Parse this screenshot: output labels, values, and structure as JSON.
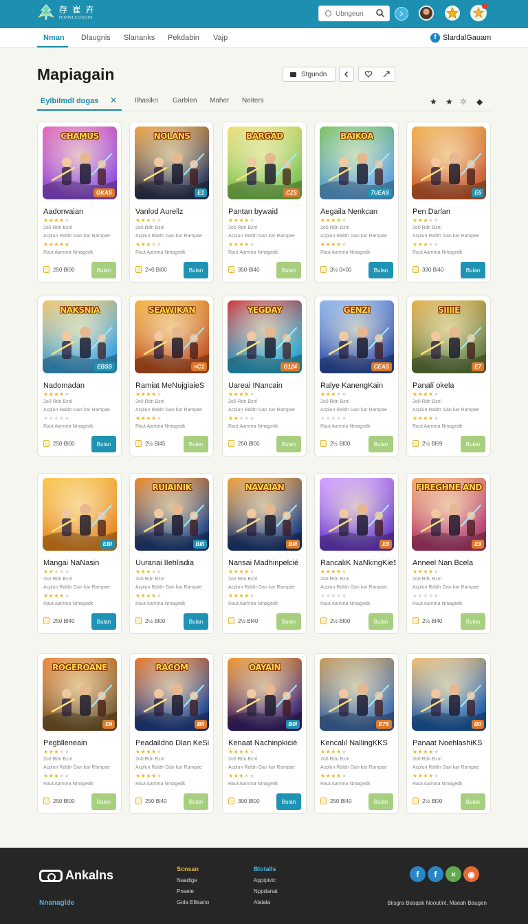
{
  "header": {
    "logo_line1": "存 崔 卉",
    "logo_line2": "RIMWLEGSOIN",
    "search_placeholder": "Ubngeun"
  },
  "nav": {
    "items": [
      "Nman",
      "Dlaugnis",
      "Slananks",
      "Pekdabin",
      "Vajp"
    ],
    "active_index": 0,
    "right_label": "SlardalGauam"
  },
  "page": {
    "title": "Mapiagain",
    "sort_label": "Stgundn",
    "filters": [
      "Eylbilmdl dogas",
      "Ilhasikn",
      "Garblen",
      "Maher",
      "Neiters"
    ]
  },
  "colors": {
    "brand": "#1d90b2",
    "buy_teal": "#1f93b3",
    "buy_green": "#a7cf7f",
    "star": "#f1b41d"
  },
  "card_template": {
    "meta1": "2o0 Rdn Bznl",
    "meta2": "Acplun Raldn Gan kar Rampae",
    "meta4": "Raut Aamma Nmagedk"
  },
  "games": [
    {
      "title": "Aadonvaian",
      "thumb_title": "CHAMUS",
      "tag": "GKAS",
      "buy": "Bulan",
      "buy_style": "green",
      "price": "250 Bl00",
      "rating1": 4,
      "rating3": 5,
      "scene": "#8f4ad8",
      "scene2": "#e46ab8"
    },
    {
      "title": "Vanlod Aurellz",
      "thumb_title": "NOLANS",
      "tag": "E1",
      "buy": "Bulan",
      "buy_style": "teal",
      "price": "2×0 Bl00",
      "rating1": 3,
      "rating3": 3,
      "scene": "#2d3553",
      "scene2": "#f0a440"
    },
    {
      "title": "Pantan bywaid",
      "thumb_title": "BARGAD",
      "tag": "CZS",
      "buy": "Bulan",
      "buy_style": "green",
      "price": "350 Bl40",
      "rating1": 4,
      "rating3": 4,
      "scene": "#7bc24e",
      "scene2": "#f1e07a"
    },
    {
      "title": "Aegaila Nenkcan",
      "thumb_title": "BAIKOA",
      "tag": "7UEAS",
      "buy": "Bulan",
      "buy_style": "teal",
      "price": "3½ 0×00",
      "rating1": 4,
      "rating3": 4,
      "scene": "#5aa0d8",
      "scene2": "#7cc460"
    },
    {
      "title": "Pen Darlan",
      "thumb_title": "",
      "tag": "E6",
      "buy": "Bulan",
      "buy_style": "teal",
      "price": "330 Bl40",
      "rating1": 3,
      "rating3": 3,
      "scene": "#c85a2b",
      "scene2": "#f2b24c"
    },
    {
      "title": "Nadomadan",
      "thumb_title": "NAKSNIA",
      "tag": "EBSS",
      "buy": "Bulan",
      "buy_style": "teal",
      "price": "250 Bl00",
      "rating1": 4,
      "rating3": 0,
      "scene": "#3b9fd8",
      "scene2": "#f3c66a"
    },
    {
      "title": "Ramiat MeNujgiaieS",
      "thumb_title": "SEAWIKAN",
      "tag": "×C1",
      "buy": "Bulan",
      "buy_style": "green",
      "price": "2½ Bl45",
      "rating1": 4,
      "rating3": 4,
      "scene": "#c0521e",
      "scene2": "#f5b540"
    },
    {
      "title": "Uareai INancain",
      "thumb_title": "YEGDAY",
      "tag": "G124",
      "buy": "Bulan",
      "buy_style": "green",
      "price": "250 Bl00",
      "rating1": 4,
      "rating3": 2,
      "scene": "#2aa0c8",
      "scene2": "#d23a3a"
    },
    {
      "title": "Ralye KanengKain",
      "thumb_title": "GENZI",
      "tag": "CEAS",
      "buy": "Bulan",
      "buy_style": "green",
      "price": "2½ Bl00",
      "rating1": 3,
      "rating3": 0,
      "scene": "#2f4ea6",
      "scene2": "#8fb6ee"
    },
    {
      "title": "Panalí okela",
      "thumb_title": "SIIIIE",
      "tag": "E7",
      "buy": "Bulan",
      "buy_style": "green",
      "price": "2½ Bl69",
      "rating1": 4,
      "rating3": 4,
      "scene": "#5f7a3a",
      "scene2": "#e7b24c"
    },
    {
      "title": "Mangai NaNasin",
      "thumb_title": "",
      "tag": "EBI",
      "buy": "Bulan",
      "buy_style": "teal",
      "price": "250 Bl40",
      "rating1": 2,
      "rating3": 4,
      "scene": "#e6871e",
      "scene2": "#f9c84a"
    },
    {
      "title": "Uuranai IIehlisdia",
      "thumb_title": "RUIAINIK",
      "tag": "BIII",
      "buy": "Bulan",
      "buy_style": "teal",
      "price": "2½ Bl00",
      "rating1": 3,
      "rating3": 4,
      "scene": "#1f3f7a",
      "scene2": "#f08a2a"
    },
    {
      "title": "Nansai Madhinpelcié",
      "thumb_title": "NAVAIAN",
      "tag": "B0I",
      "buy": "Bulan",
      "buy_style": "green",
      "price": "2½ Bl40",
      "rating1": 4,
      "rating3": 4,
      "scene": "#1c3a78",
      "scene2": "#f4a038"
    },
    {
      "title": "RancalıK NaNkingKieS",
      "thumb_title": "",
      "tag": "E9",
      "buy": "Bulan",
      "buy_style": "green",
      "price": "2½ Bl00",
      "rating1": 4,
      "rating3": 0,
      "scene": "#6a3cc8",
      "scene2": "#d6a0ff"
    },
    {
      "title": "Anneel Nan Bcela",
      "thumb_title": "FIREGHNE AND",
      "tag": "E9",
      "buy": "Bulan",
      "buy_style": "green",
      "price": "2½ Bl40",
      "rating1": 4,
      "rating3": 0,
      "scene": "#b43a6c",
      "scene2": "#f2ad6c"
    },
    {
      "title": "Pegblleneain",
      "thumb_title": "ROGEROANE",
      "tag": "E9",
      "buy": "Bulan",
      "buy_style": "green",
      "price": "250 Bl00",
      "rating1": 3,
      "rating3": 3,
      "scene": "#7a5a2a",
      "scene2": "#ee8a3a"
    },
    {
      "title": "Peadaildno Dlan KeSi",
      "thumb_title": "RACOM",
      "tag": "BII",
      "buy": "Bulan",
      "buy_style": "green",
      "price": "250 Bl40",
      "rating1": 4,
      "rating3": 4,
      "scene": "#21408a",
      "scene2": "#ef7a28"
    },
    {
      "title": "Kenaat Nachinpkicié",
      "thumb_title": "OAYAIN",
      "tag": "B0I",
      "buy": "Bulan",
      "buy_style": "teal",
      "price": "300 Bl00",
      "rating1": 4,
      "rating3": 3,
      "scene": "#3a1f6a",
      "scene2": "#f39a2e"
    },
    {
      "title": "Kencalıl NallingKKS",
      "thumb_title": "",
      "tag": "E7S",
      "buy": "Bulan",
      "buy_style": "green",
      "price": "250 Bl40",
      "rating1": 4,
      "rating3": 4,
      "scene": "#3d6aa8",
      "scene2": "#c89b58"
    },
    {
      "title": "Panaat NoehlashiKS",
      "thumb_title": "",
      "tag": "B0",
      "buy": "Bulan",
      "buy_style": "green",
      "price": "2½ Bl00",
      "rating1": 4,
      "rating3": 4,
      "scene": "#1b5aa8",
      "scene2": "#f4c070"
    }
  ],
  "footer": {
    "logo": "Ankalns",
    "subtitle": "Nnanaglde",
    "col1": {
      "head": "Scnsan",
      "links": [
        "Naadige",
        "Pnaele",
        "Gola Ellisano"
      ]
    },
    "col2": {
      "head": "Blotalls",
      "links": [
        "Appipivic",
        "Nppdanat",
        "Alalala"
      ]
    },
    "socials": [
      {
        "icon": "facebook-icon",
        "glyph": "f",
        "color": "#2a86c6"
      },
      {
        "icon": "facebook-icon",
        "glyph": "f",
        "color": "#2a86c6"
      },
      {
        "icon": "close-icon",
        "glyph": "×",
        "color": "#65aa52"
      },
      {
        "icon": "reddit-icon",
        "glyph": "◉",
        "color": "#e56a33"
      }
    ],
    "copyright": "Biisgra Beaqak Nooutint,  Maeah  Baugen"
  }
}
